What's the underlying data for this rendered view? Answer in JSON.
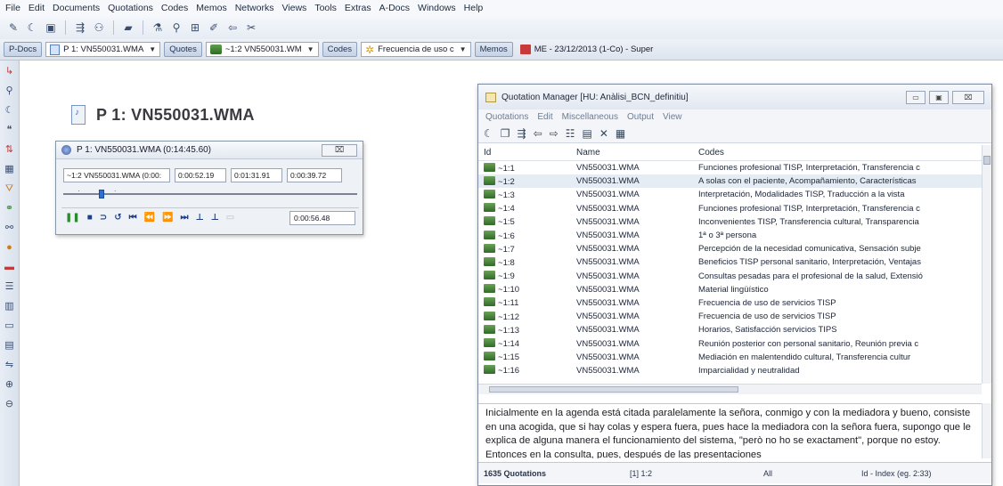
{
  "menubar": [
    "File",
    "Edit",
    "Documents",
    "Quotations",
    "Codes",
    "Memos",
    "Networks",
    "Views",
    "Tools",
    "Extras",
    "A-Docs",
    "Windows",
    "Help"
  ],
  "selector": {
    "pdocs_label": "P-Docs",
    "pdocs_value": "P 1: VN550031.WMA",
    "quotes_label": "Quotes",
    "quotes_value": "~1:2 VN550031.WM",
    "codes_label": "Codes",
    "codes_value": "Frecuencia de uso c",
    "memos_label": "Memos",
    "memos_value": "ME - 23/12/2013 (1-Co) - Super"
  },
  "document": {
    "title": "P 1: VN550031.WMA"
  },
  "player": {
    "title": "P 1: VN550031.WMA (0:14:45.60)",
    "quote_field": "~1:2 VN550031.WMA (0:00:",
    "start": "0:00:52.19",
    "end": "0:01:31.91",
    "duration": "0:00:39.72",
    "current_time": "0:00:56.48"
  },
  "qm": {
    "title": "Quotation Manager [HU: Anàlisi_BCN_definitiu]",
    "menu": [
      "Quotations",
      "Edit",
      "Miscellaneous",
      "Output",
      "View"
    ],
    "columns": {
      "id": "Id",
      "name": "Name",
      "codes": "Codes"
    },
    "rows": [
      {
        "id": "1:1",
        "name": "VN550031.WMA",
        "codes": "Funciones profesional TISP, Interpretación, Transferencia c"
      },
      {
        "id": "1:2",
        "name": "VN550031.WMA",
        "codes": "A solas con el paciente, Acompañamiento, Características"
      },
      {
        "id": "1:3",
        "name": "VN550031.WMA",
        "codes": "Interpretación, Modalidades TISP, Traducción a la vista"
      },
      {
        "id": "1:4",
        "name": "VN550031.WMA",
        "codes": "Funciones profesional TISP, Interpretación, Transferencia c"
      },
      {
        "id": "1:5",
        "name": "VN550031.WMA",
        "codes": "Inconvenientes TISP, Transferencia cultural, Transparencia"
      },
      {
        "id": "1:6",
        "name": "VN550031.WMA",
        "codes": "1ª o 3ª persona"
      },
      {
        "id": "1:7",
        "name": "VN550031.WMA",
        "codes": "Percepción de la necesidad comunicativa, Sensación subje"
      },
      {
        "id": "1:8",
        "name": "VN550031.WMA",
        "codes": "Beneficios TISP personal sanitario, Interpretación, Ventajas"
      },
      {
        "id": "1:9",
        "name": "VN550031.WMA",
        "codes": "Consultas pesadas para el profesional de la salud, Extensió"
      },
      {
        "id": "1:10",
        "name": "VN550031.WMA",
        "codes": "Material lingüístico"
      },
      {
        "id": "1:11",
        "name": "VN550031.WMA",
        "codes": "Frecuencia de uso de servicios TISP"
      },
      {
        "id": "1:12",
        "name": "VN550031.WMA",
        "codes": "Frecuencia de uso de servicios TISP"
      },
      {
        "id": "1:13",
        "name": "VN550031.WMA",
        "codes": "Horarios, Satisfacción servicios TIPS"
      },
      {
        "id": "1:14",
        "name": "VN550031.WMA",
        "codes": "Reunión posterior con personal sanitario, Reunión previa c"
      },
      {
        "id": "1:15",
        "name": "VN550031.WMA",
        "codes": "Mediación en malentendido cultural, Transferencia cultur"
      },
      {
        "id": "1:16",
        "name": "VN550031.WMA",
        "codes": "Imparcialidad y neutralidad"
      }
    ],
    "quote_text": "Inicialmente en la agenda está citada paralelamente la señora, conmigo y con la mediadora y bueno, consiste en una acogida, que si hay colas y espera fuera, pues hace la mediadora con la señora fuera, supongo que le explica de alguna manera el funcionamiento del sistema, \"però no ho se exactament\", porque no estoy. Entonces en la consulta, pues, después de las presentaciones",
    "status": {
      "count": "1635 Quotations",
      "selection": "[1] 1:2",
      "filter": "All",
      "sort": "Id - Index (eg. 2:33)"
    }
  }
}
